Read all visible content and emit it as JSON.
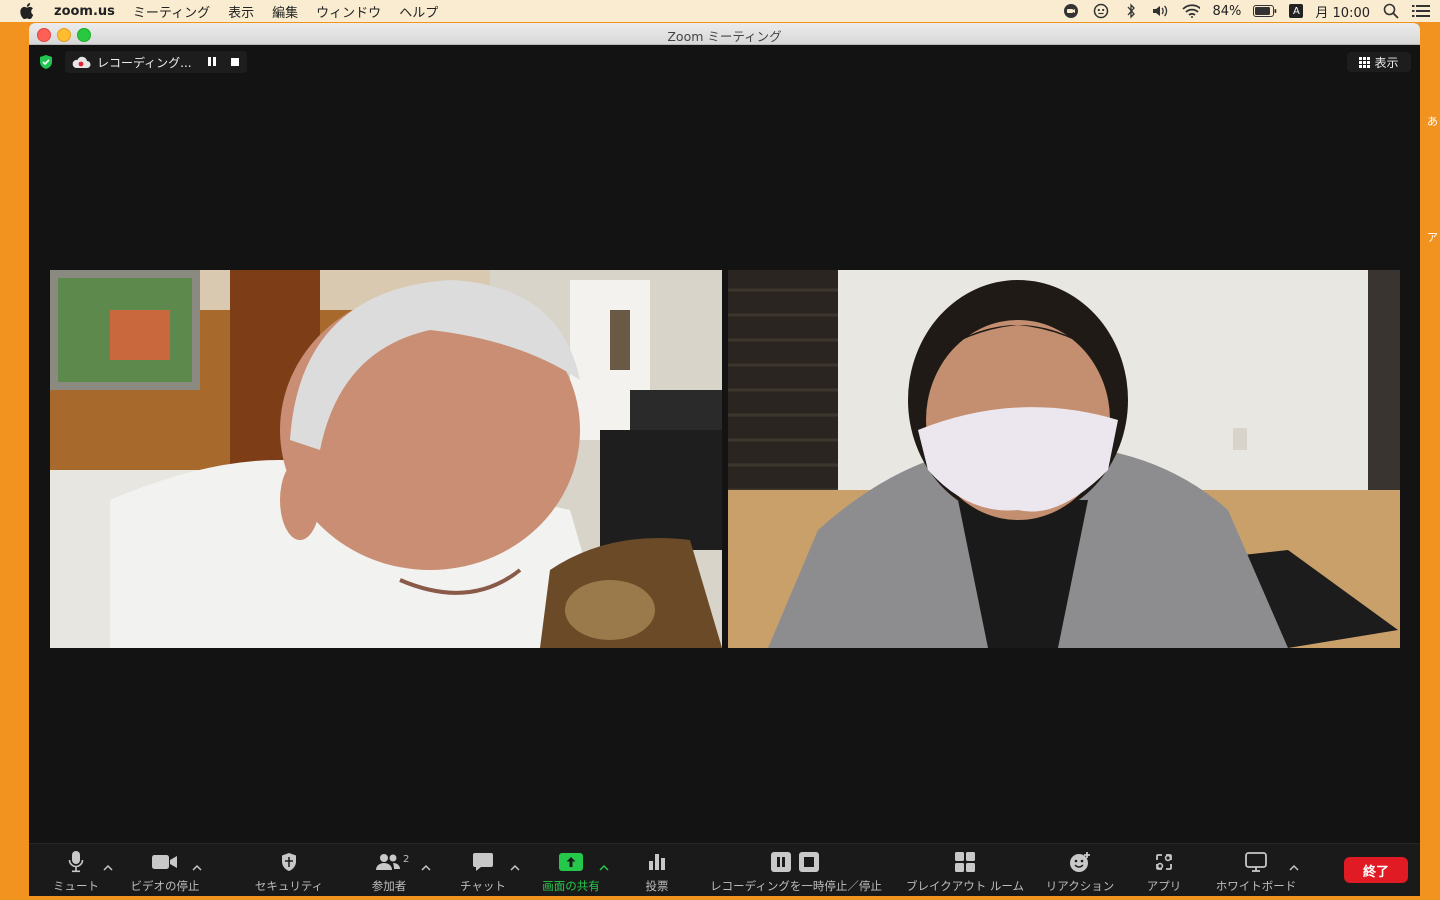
{
  "menubar": {
    "app_name": "zoom.us",
    "items": [
      "ミーティング",
      "表示",
      "編集",
      "ウィンドウ",
      "ヘルプ"
    ],
    "battery": "84%",
    "ime": "A",
    "clock": "月 10:00",
    "status_icons": [
      "zoom-status-icon",
      "face-icon",
      "bluetooth-icon",
      "volume-icon",
      "wifi-icon",
      "battery-icon",
      "input-method-icon",
      "search-icon",
      "list-icon"
    ]
  },
  "window": {
    "title": "Zoom ミーティング"
  },
  "overlay": {
    "recording_label": "レコーディング...",
    "view_label": "表示"
  },
  "edge": {
    "text1": "あ",
    "text2": "ア"
  },
  "toolbar": {
    "mute": "ミュート",
    "stop_video": "ビデオの停止",
    "security": "セキュリティ",
    "participants": "参加者",
    "participants_count": "2",
    "chat": "チャット",
    "share": "画面の共有",
    "poll": "投票",
    "recording": "レコーディングを一時停止／停止",
    "breakout": "ブレイクアウト ルーム",
    "reactions": "リアクション",
    "apps": "アプリ",
    "whiteboard": "ホワイトボード",
    "end": "終了"
  },
  "colors": {
    "desktop": "#f3931f",
    "window_bg": "#131313",
    "share_green": "#25c84a",
    "end_red": "#e01b23"
  }
}
